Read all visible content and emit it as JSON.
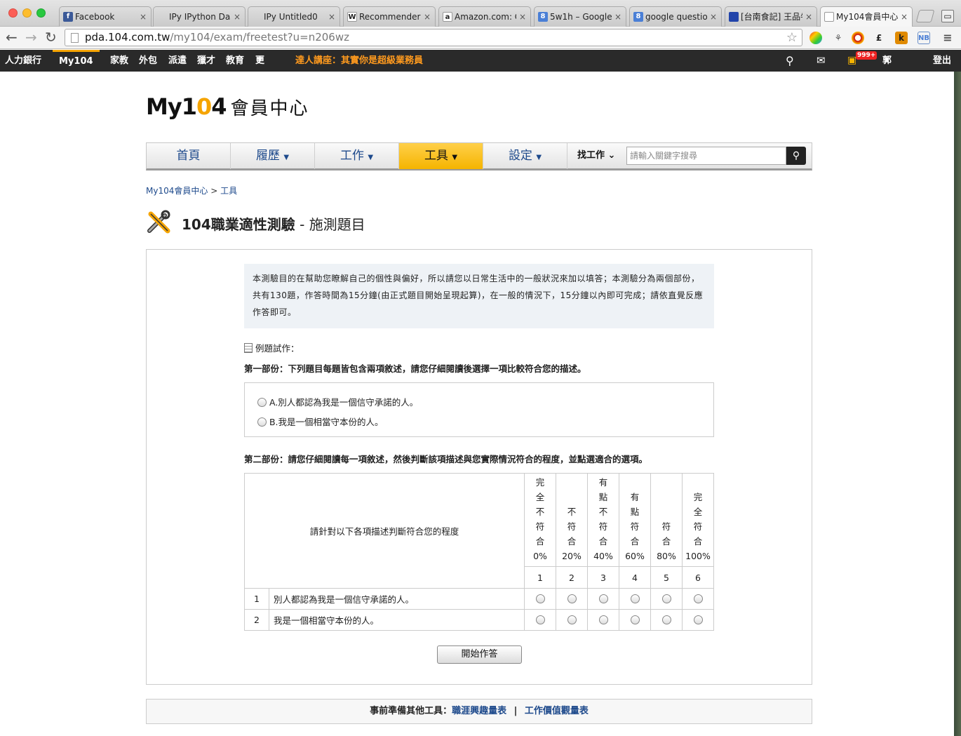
{
  "browser": {
    "tabs": [
      {
        "label": "Facebook",
        "icon": "facebook-icon",
        "color": "#3b5998",
        "glyph": "f",
        "active": false
      },
      {
        "label": "IPy IPython Dashbo",
        "icon": "ipython-icon",
        "color": "",
        "glyph": "",
        "active": false
      },
      {
        "label": "IPy Untitled0",
        "icon": "ipython-icon",
        "color": "",
        "glyph": "",
        "active": false
      },
      {
        "label": "Recommender s",
        "icon": "wikipedia-icon",
        "color": "#fff",
        "glyph": "W",
        "active": false
      },
      {
        "label": "Amazon.com: C",
        "icon": "amazon-icon",
        "color": "#fff",
        "glyph": "a",
        "active": false
      },
      {
        "label": "5w1h – Google",
        "icon": "google-icon",
        "color": "#4a7fd6",
        "glyph": "8",
        "active": false
      },
      {
        "label": "google question",
        "icon": "google-icon",
        "color": "#4a7fd6",
        "glyph": "8",
        "active": false
      },
      {
        "label": "[台南食記] 王品牛",
        "icon": "blog-icon",
        "color": "#2244aa",
        "glyph": "",
        "active": false
      },
      {
        "label": "My104會員中心",
        "icon": "page-icon",
        "color": "#fff",
        "glyph": "",
        "active": true
      }
    ],
    "url_host": "pda.104.com.tw",
    "url_path": "/my104/exam/freetest?u=n206wz"
  },
  "site_bar": {
    "items": [
      "人力銀行",
      "My104",
      "家教",
      "外包",
      "派遣",
      "獵才",
      "教育",
      "更多"
    ],
    "promo": "達人講座：其實你是超級業務員",
    "badge": "999+",
    "user": "郭韋廷",
    "logout": "登出"
  },
  "logo": {
    "text_a": "My1",
    "text_o": "0",
    "text_b": "4",
    "sub": "會員中心"
  },
  "nav": {
    "items": [
      "首頁",
      "履歷",
      "工作",
      "工具",
      "設定"
    ],
    "search_label": "找工作",
    "search_placeholder": "請輸入關鍵字搜尋"
  },
  "breadcrumb": {
    "home": "My104會員中心",
    "sep": ">",
    "current": "工具"
  },
  "page": {
    "title_bold": "104職業適性測驗",
    "title_sep": " - ",
    "title_rest": "施測題目"
  },
  "intro": "本測驗目的在幫助您瞭解自己的個性與偏好，所以請您以日常生活中的一般狀況來加以填答；本測驗分為兩個部份，共有130題，作答時間為15分鐘(由正式題目開始呈現起算)，在一般的情況下，15分鐘以內即可完成；請依直覺反應作答即可。",
  "example_label": "例題試作：",
  "part1": {
    "title": "第一部份：下列題目每題皆包含兩項敘述，請您仔細閱讀後選擇一項比較符合您的描述。",
    "option_a": "A.別人都認為我是一個信守承諾的人。",
    "option_b": "B.我是一個相當守本份的人。"
  },
  "part2": {
    "title": "第二部份：請您仔細閱讀每一項敘述，然後判斷該項描述與您實際情況符合的程度，並點選適合的選項。",
    "header": "請針對以下各項描述判斷符合您的程度",
    "scale": [
      {
        "label": "完全不符合",
        "pct": "0%",
        "num": "1"
      },
      {
        "label": "不符合",
        "pct": "20%",
        "num": "2"
      },
      {
        "label": "有點不符合",
        "pct": "40%",
        "num": "3"
      },
      {
        "label": "有點符合",
        "pct": "60%",
        "num": "4"
      },
      {
        "label": "符合",
        "pct": "80%",
        "num": "5"
      },
      {
        "label": "完全符合",
        "pct": "100%",
        "num": "6"
      }
    ],
    "rows": [
      {
        "no": "1",
        "text": "別人都認為我是一個信守承諾的人。"
      },
      {
        "no": "2",
        "text": "我是一個相當守本份的人。"
      }
    ]
  },
  "start_button": "開始作答",
  "footer": {
    "prefix": "事前準備其他工具：",
    "link1": "職涯興趣量表",
    "sep": "|",
    "link2": "工作價值觀量表"
  },
  "colors": {
    "accent": "#f5a400",
    "link": "#1e4a8c",
    "promo": "#ff9a1e"
  }
}
